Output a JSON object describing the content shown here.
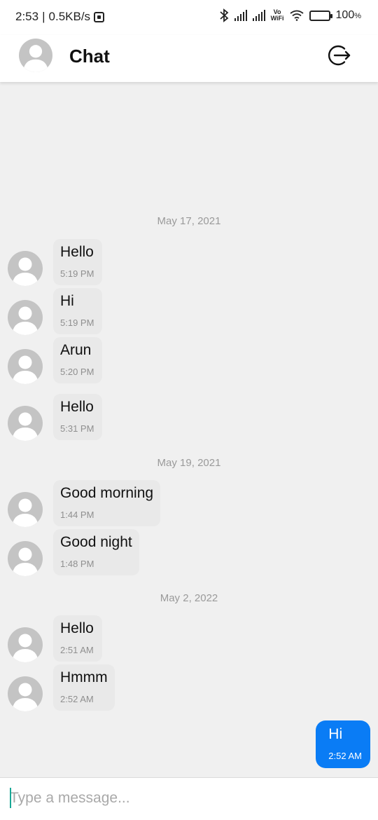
{
  "status_bar": {
    "time": "2:53",
    "network_speed": "0.5KB/s",
    "volte_line1": "Vo",
    "volte_line2": "WiFi",
    "battery": "100",
    "battery_unit": "%",
    "icons": [
      "bluetooth-icon",
      "signal-icon",
      "wifi-icon",
      "battery-icon"
    ]
  },
  "app_bar": {
    "title": "Chat",
    "icons": [
      "profile-avatar",
      "logout-icon"
    ]
  },
  "messages": {
    "groups": [
      {
        "date": "May 17, 2021",
        "items": [
          {
            "text": "Hello",
            "time": "5:19 PM"
          },
          {
            "text": "Hi",
            "time": "5:19 PM"
          },
          {
            "text": "Arun",
            "time": "5:20 PM"
          },
          {
            "text": "Hello",
            "time": "5:31 PM"
          }
        ]
      },
      {
        "date": "May 19, 2021",
        "items": [
          {
            "text": "Good morning",
            "time": "1:44 PM"
          },
          {
            "text": "Good night",
            "time": "1:48 PM"
          }
        ]
      },
      {
        "date": "May 2, 2022",
        "items": [
          {
            "text": "Hello",
            "time": "2:51 AM"
          },
          {
            "text": "Hmmm",
            "time": "2:52 AM"
          }
        ]
      }
    ],
    "outgoing": {
      "text": "Hi",
      "time": "2:52 AM"
    }
  },
  "composer": {
    "placeholder": "Type a message...",
    "value": ""
  },
  "colors": {
    "outgoing_bubble": "#0a7cf5",
    "incoming_bubble": "#e9e9e9",
    "background": "#f0f0f0",
    "caret": "#19a896"
  }
}
